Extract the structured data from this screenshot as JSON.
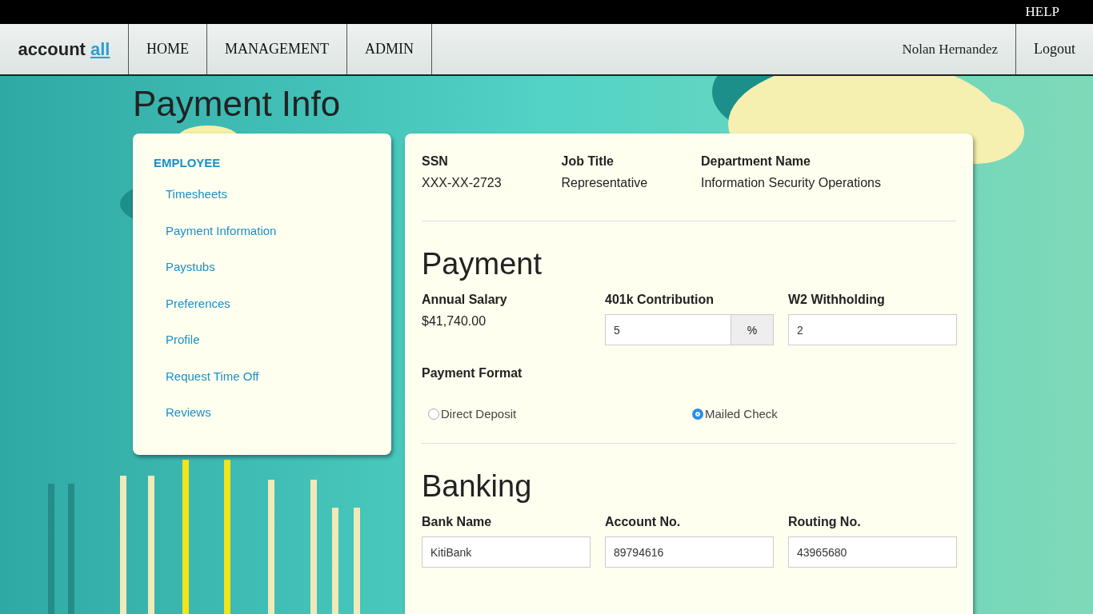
{
  "top_bar": {
    "help": "HELP"
  },
  "nav": {
    "logo": {
      "text": "account",
      "accent": "all"
    },
    "items": [
      "HOME",
      "MANAGEMENT",
      "ADMIN"
    ],
    "user": "Nolan Hernandez",
    "logout": "Logout"
  },
  "page_title": "Payment Info",
  "sidebar": {
    "heading": "EMPLOYEE",
    "items": [
      "Timesheets",
      "Payment Information",
      "Paystubs",
      "Preferences",
      "Profile",
      "Request Time Off",
      "Reviews"
    ]
  },
  "summary": [
    {
      "label": "SSN",
      "value": "XXX-XX-2723"
    },
    {
      "label": "Job Title",
      "value": "Representative"
    },
    {
      "label": "Department Name",
      "value": "Information Security Operations"
    }
  ],
  "payment": {
    "title": "Payment",
    "salary": {
      "label": "Annual Salary",
      "value": "$41,740.00"
    },
    "contribution": {
      "label": "401k Contribution",
      "value": "5",
      "suffix": "%"
    },
    "withholding": {
      "label": "W2 Withholding",
      "value": "2"
    },
    "format": {
      "label": "Payment Format",
      "options": [
        {
          "label": "Direct Deposit",
          "selected": false
        },
        {
          "label": "Mailed Check",
          "selected": true
        }
      ]
    }
  },
  "banking": {
    "title": "Banking",
    "fields": [
      {
        "label": "Bank Name",
        "value": "KitiBank"
      },
      {
        "label": "Account No.",
        "value": "89794616"
      },
      {
        "label": "Routing No.",
        "value": "43965680"
      }
    ]
  }
}
